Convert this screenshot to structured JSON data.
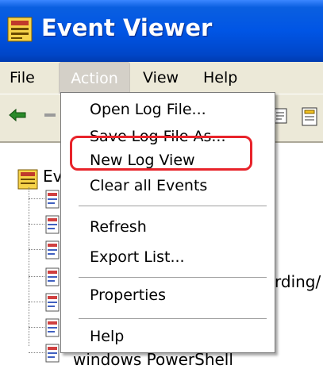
{
  "window": {
    "title": "Event Viewer"
  },
  "menubar": {
    "items": [
      {
        "label": "File"
      },
      {
        "label": "Action"
      },
      {
        "label": "View"
      },
      {
        "label": "Help"
      }
    ]
  },
  "tree": {
    "root_label": "Ev",
    "partial_labels": [
      "rding/",
      "windows PowerShell"
    ]
  },
  "action_menu": {
    "items": [
      {
        "label": "Open Log File..."
      },
      {
        "label": "Save Log File As..."
      },
      {
        "label": "New Log View"
      },
      {
        "label": "Clear all Events"
      },
      {
        "label": "Refresh"
      },
      {
        "label": "Export List..."
      },
      {
        "label": "Properties"
      },
      {
        "label": "Help"
      }
    ],
    "highlighted_item": "Save Log File As...",
    "highlight_color": "#e8232a"
  },
  "colors": {
    "titlebar": "#0055e5",
    "menubar_bg": "#ece9d8"
  }
}
